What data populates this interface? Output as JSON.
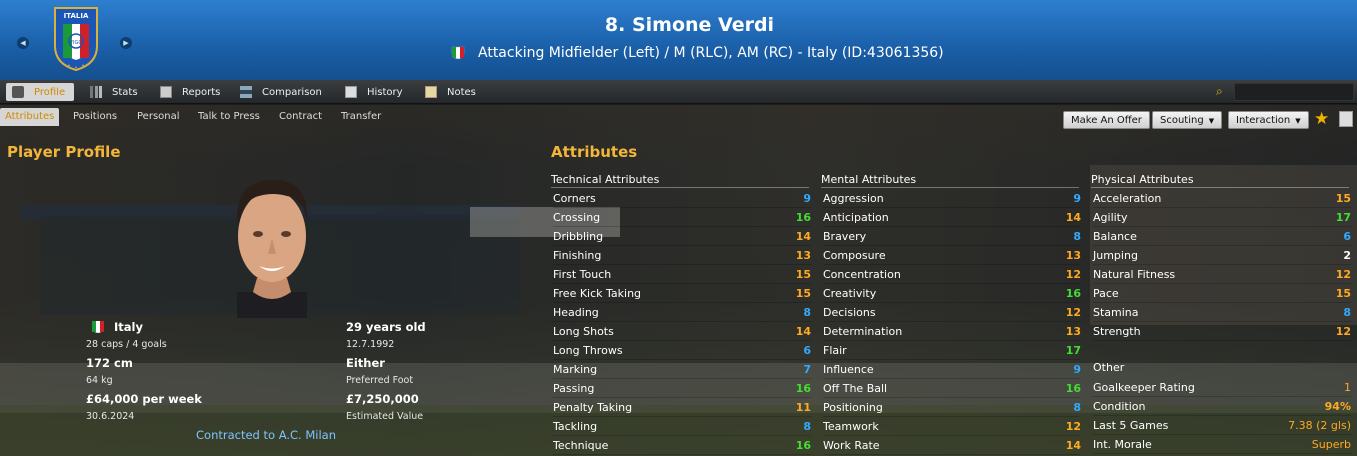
{
  "header": {
    "title": "8. Simone Verdi",
    "subtitle": "Attacking Midfielder (Left) / M (RLC), AM (RC) - Italy (ID:43061356)",
    "crest_text": "ITALIA",
    "crest_small": "FIGC",
    "nav_prev": "◀",
    "nav_next": "▶"
  },
  "tabs": [
    "Profile",
    "Stats",
    "Reports",
    "Comparison",
    "History",
    "Notes"
  ],
  "subtabs": [
    "Attributes",
    "Positions",
    "Personal",
    "Talk to Press",
    "Contract",
    "Transfer"
  ],
  "buttons": {
    "offer": "Make An Offer",
    "scouting": "Scouting",
    "interaction": "Interaction",
    "dropdown_arrow": "▼"
  },
  "profile": {
    "heading": "Player Profile",
    "nation": "Italy",
    "caps": "28 caps / 4 goals",
    "age": "29 years old",
    "dob": "12.7.1992",
    "height": "172 cm",
    "weight": "64 kg",
    "foot": "Either",
    "foot_label": "Preferred Foot",
    "wage": "£64,000 per week",
    "contract_end": "30.6.2024",
    "value": "£7,250,000",
    "value_label": "Estimated Value",
    "contract": "Contracted to A.C. Milan"
  },
  "attributes_heading": "Attributes",
  "colors": {
    "green": "#44dd33",
    "orange": "#ffaa22",
    "blue": "#33aaff",
    "white": "#ffffff"
  },
  "technical": {
    "heading": "Technical Attributes",
    "items": [
      {
        "name": "Corners",
        "value": "9",
        "color": "#33aaff"
      },
      {
        "name": "Crossing",
        "value": "16",
        "color": "#44dd33"
      },
      {
        "name": "Dribbling",
        "value": "14",
        "color": "#ffaa22"
      },
      {
        "name": "Finishing",
        "value": "13",
        "color": "#ffaa22"
      },
      {
        "name": "First Touch",
        "value": "15",
        "color": "#ffaa22"
      },
      {
        "name": "Free Kick Taking",
        "value": "15",
        "color": "#ffaa22"
      },
      {
        "name": "Heading",
        "value": "8",
        "color": "#33aaff"
      },
      {
        "name": "Long Shots",
        "value": "14",
        "color": "#ffaa22"
      },
      {
        "name": "Long Throws",
        "value": "6",
        "color": "#33aaff"
      },
      {
        "name": "Marking",
        "value": "7",
        "color": "#33aaff"
      },
      {
        "name": "Passing",
        "value": "16",
        "color": "#44dd33"
      },
      {
        "name": "Penalty Taking",
        "value": "11",
        "color": "#ffaa22"
      },
      {
        "name": "Tackling",
        "value": "8",
        "color": "#33aaff"
      },
      {
        "name": "Technique",
        "value": "16",
        "color": "#44dd33"
      }
    ]
  },
  "mental": {
    "heading": "Mental Attributes",
    "items": [
      {
        "name": "Aggression",
        "value": "9",
        "color": "#33aaff"
      },
      {
        "name": "Anticipation",
        "value": "14",
        "color": "#ffaa22"
      },
      {
        "name": "Bravery",
        "value": "8",
        "color": "#33aaff"
      },
      {
        "name": "Composure",
        "value": "13",
        "color": "#ffaa22"
      },
      {
        "name": "Concentration",
        "value": "12",
        "color": "#ffaa22"
      },
      {
        "name": "Creativity",
        "value": "16",
        "color": "#44dd33"
      },
      {
        "name": "Decisions",
        "value": "12",
        "color": "#ffaa22"
      },
      {
        "name": "Determination",
        "value": "13",
        "color": "#ffaa22"
      },
      {
        "name": "Flair",
        "value": "17",
        "color": "#44dd33"
      },
      {
        "name": "Influence",
        "value": "9",
        "color": "#33aaff"
      },
      {
        "name": "Off The Ball",
        "value": "16",
        "color": "#44dd33"
      },
      {
        "name": "Positioning",
        "value": "8",
        "color": "#33aaff"
      },
      {
        "name": "Teamwork",
        "value": "12",
        "color": "#ffaa22"
      },
      {
        "name": "Work Rate",
        "value": "14",
        "color": "#ffaa22"
      }
    ]
  },
  "physical": {
    "heading": "Physical Attributes",
    "items": [
      {
        "name": "Acceleration",
        "value": "15",
        "color": "#ffaa22"
      },
      {
        "name": "Agility",
        "value": "17",
        "color": "#44dd33"
      },
      {
        "name": "Balance",
        "value": "6",
        "color": "#33aaff"
      },
      {
        "name": "Jumping",
        "value": "2",
        "color": "#ffffff"
      },
      {
        "name": "Natural Fitness",
        "value": "12",
        "color": "#ffaa22"
      },
      {
        "name": "Pace",
        "value": "15",
        "color": "#ffaa22"
      },
      {
        "name": "Stamina",
        "value": "8",
        "color": "#33aaff"
      },
      {
        "name": "Strength",
        "value": "12",
        "color": "#ffaa22"
      }
    ]
  },
  "other": {
    "heading": "Other",
    "items": [
      {
        "name": "Goalkeeper Rating",
        "value": "1",
        "color": "#ffaa22"
      },
      {
        "name": "Condition",
        "value": "94%",
        "color": "#ffaa22"
      },
      {
        "name": "Last 5 Games",
        "value": "7.38 (2 gls)",
        "color": "#ffaa22"
      },
      {
        "name": "Int. Morale",
        "value": "Superb",
        "color": "#ffaa22"
      }
    ]
  }
}
